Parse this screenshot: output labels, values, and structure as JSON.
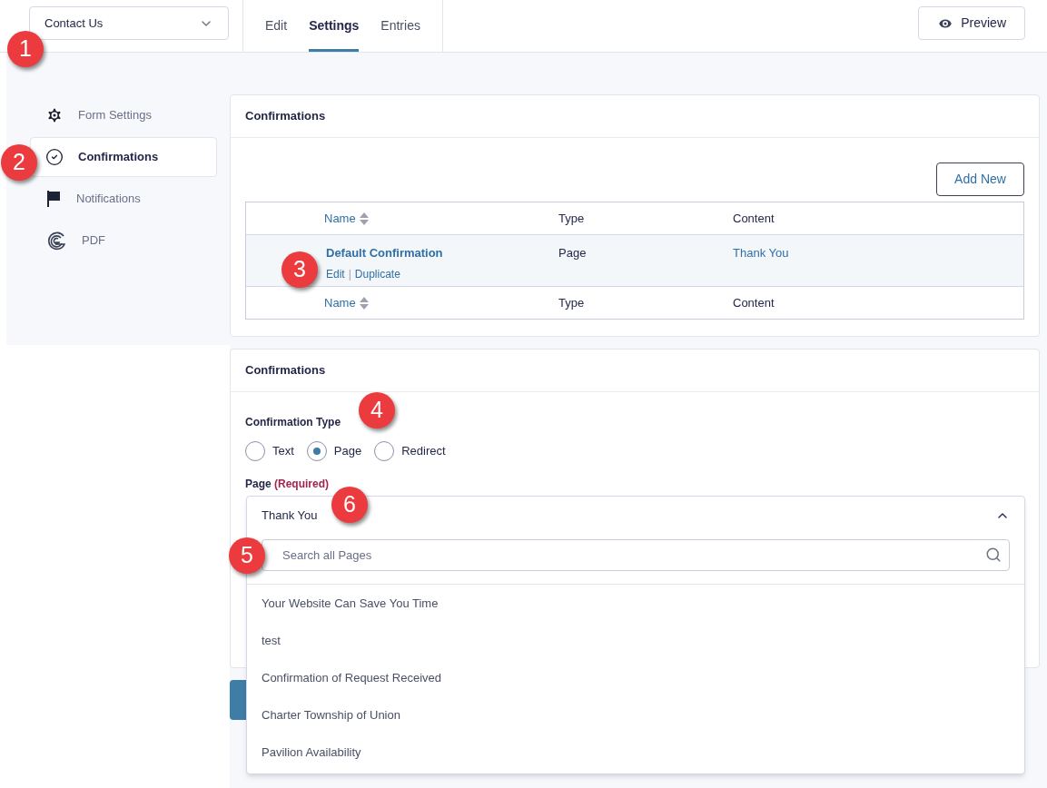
{
  "form_selector": {
    "value": "Contact Us"
  },
  "tabs": [
    {
      "label": "Edit",
      "selected": false
    },
    {
      "label": "Settings",
      "selected": true
    },
    {
      "label": "Entries",
      "selected": false
    }
  ],
  "preview_button": {
    "label": "Preview"
  },
  "sidebar": {
    "items": [
      {
        "label": "Form Settings",
        "kind": "gear",
        "selected": false
      },
      {
        "label": "Confirmations",
        "kind": "check",
        "selected": true
      },
      {
        "label": "Notifications",
        "kind": "flag",
        "selected": false
      },
      {
        "label": "PDF",
        "kind": "pdf",
        "selected": false
      }
    ]
  },
  "confirmations_list": {
    "title": "Confirmations",
    "add_button": "Add New",
    "columns": [
      "Name",
      "Type",
      "Content"
    ],
    "rows": [
      {
        "name": "Default Confirmation",
        "actions": [
          "Edit",
          "Duplicate"
        ],
        "separator": "|",
        "type": "Page",
        "content": "Thank You"
      }
    ],
    "footer_columns": [
      "Name",
      "Type",
      "Content"
    ]
  },
  "confirmation_editor": {
    "title": "Confirmations",
    "type_label": "Confirmation Type",
    "types": [
      {
        "label": "Text",
        "selected": false
      },
      {
        "label": "Page",
        "selected": true
      },
      {
        "label": "Redirect",
        "selected": false
      }
    ],
    "page_label": "Page",
    "required": "(Required)",
    "page_select": {
      "value": "Thank You",
      "expanded": true,
      "search_placeholder": "Search all Pages",
      "options": [
        "Your Website Can Save You Time",
        "test",
        "Confirmation of Request Received",
        "Charter Township of Union",
        "Pavilion Availability"
      ]
    }
  },
  "callouts": [
    {
      "label": "1"
    },
    {
      "label": "2"
    },
    {
      "label": "3"
    },
    {
      "label": "4"
    },
    {
      "label": "5"
    },
    {
      "label": "6"
    }
  ]
}
